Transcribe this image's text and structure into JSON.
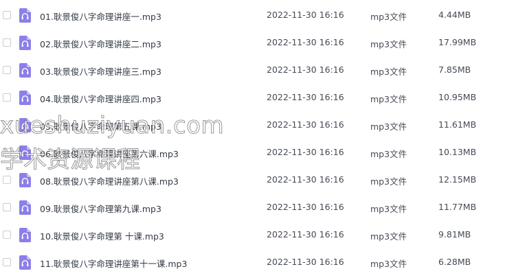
{
  "icons": {
    "row_icon": "headphones-audio-file-icon",
    "icon_color": "#8b7fe8"
  },
  "files": [
    {
      "name": "01.耿景俊八字命理讲座一.mp3",
      "date": "2022-11-30 16:16",
      "type": "mp3文件",
      "size": "4.44MB"
    },
    {
      "name": "02.耿景俊八字命理讲座二.mp3",
      "date": "2022-11-30 16:16",
      "type": "mp3文件",
      "size": "17.99MB"
    },
    {
      "name": "03.耿景俊八字命理讲座三.mp3",
      "date": "2022-11-30 16:16",
      "type": "mp3文件",
      "size": "7.85MB"
    },
    {
      "name": "04.耿景俊八字命理讲座四.mp3",
      "date": "2022-11-30 16:16",
      "type": "mp3文件",
      "size": "10.95MB"
    },
    {
      "name": "05.耿景俊八字命理第五课.mp3",
      "date": "2022-11-30 16:16",
      "type": "mp3文件",
      "size": "11.61MB"
    },
    {
      "name": "06.耿景俊八字命理讲座第六课.mp3",
      "date": "2022-11-30 16:16",
      "type": "mp3文件",
      "size": "10.13MB"
    },
    {
      "name": "08.耿景俊八字命理讲座第八课.mp3",
      "date": "2022-11-30 16:16",
      "type": "mp3文件",
      "size": "12.15MB"
    },
    {
      "name": "09.耿景俊八字命理第九课.mp3",
      "date": "2022-11-30 16:16",
      "type": "mp3文件",
      "size": "11.77MB"
    },
    {
      "name": "10.耿景俊八字命理第 十课.mp3",
      "date": "2022-11-30 16:16",
      "type": "mp3文件",
      "size": "9.81MB"
    },
    {
      "name": "11.耿景俊八字命理讲座第十一课.mp3",
      "date": "2022-11-30 16:16",
      "type": "mp3文件",
      "size": "6.28MB"
    }
  ],
  "watermark": {
    "line1": "xueshuziyuan.com",
    "line2": "学术资源课程"
  }
}
